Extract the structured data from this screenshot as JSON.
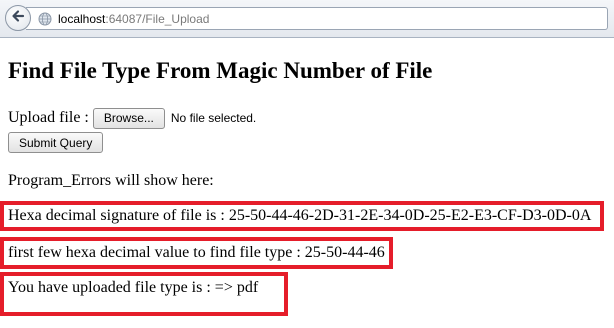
{
  "browser": {
    "url_host": "localhost",
    "url_rest": ":64087/File_Upload",
    "back_icon": "back-arrow-icon",
    "site_icon": "globe-icon"
  },
  "page": {
    "title": "Find File Type From Magic Number of File",
    "upload_label": "Upload file :",
    "browse_label": "Browse...",
    "file_status": "No file selected.",
    "submit_label": "Submit Query",
    "errors_label": "Program_Errors will show here:"
  },
  "results": {
    "signature_text": "Hexa decimal signature of file is : 25-50-44-46-2D-31-2E-34-0D-25-E2-E3-CF-D3-0D-0A",
    "first_hex_text": "first few hexa decimal value to find file type : 25-50-44-46",
    "file_type_text": "You have uploaded file type is : => pdf"
  },
  "colors": {
    "highlight_border": "#e51d2a"
  }
}
